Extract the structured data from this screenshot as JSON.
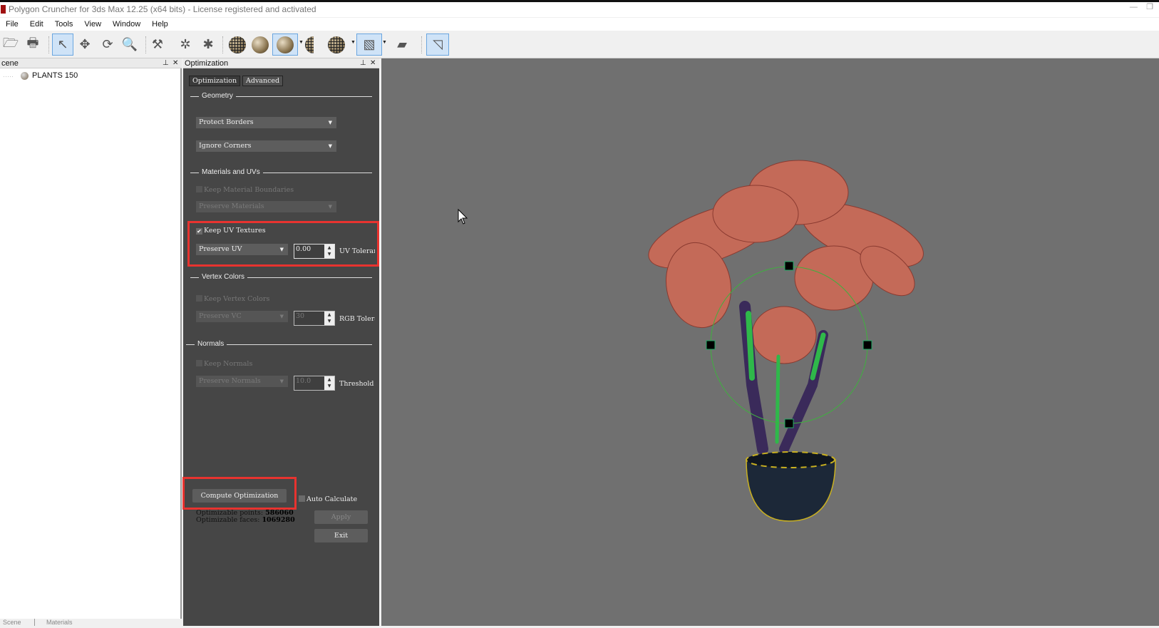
{
  "window": {
    "title": "Polygon Cruncher for 3ds Max 12.25 (x64 bits) - License registered and activated"
  },
  "menu": [
    "File",
    "Edit",
    "Tools",
    "View",
    "Window",
    "Help"
  ],
  "toolbar": {
    "icons": [
      "open-icon",
      "print-icon",
      "select-arrow-icon",
      "move-icon",
      "rotate-icon",
      "zoom-icon",
      "tools-icon",
      "wireframe-icon",
      "star-mesh-icon",
      "sphere-grid-icon",
      "sphere-smooth-icon",
      "sphere-shaded-icon",
      "sphere-half-icon",
      "sphere-half-grid-icon",
      "texture-icon",
      "material-icon",
      "viewport-icon"
    ],
    "selected": [
      "select-arrow-icon",
      "sphere-shaded-icon",
      "texture-icon",
      "viewport-icon"
    ]
  },
  "scene_panel": {
    "title": "cene",
    "tree": [
      {
        "label": "PLANTS 150"
      }
    ],
    "tabs": [
      "Scene",
      "Materials"
    ]
  },
  "optimization_panel": {
    "title": "Optimization",
    "tabs": [
      "Optimization",
      "Advanced"
    ],
    "geometry": {
      "header": "Geometry",
      "dropdown1": "Protect Borders",
      "dropdown2": "Ignore Corners"
    },
    "materials": {
      "header": "Materials and UVs",
      "keep_material_boundaries": "Keep Material Boundaries",
      "preserve_materials": "Preserve Materials",
      "keep_uv_textures": "Keep UV Textures",
      "keep_uv_checked": true,
      "preserve_uv": "Preserve UV",
      "uv_tolerance_value": "0.00",
      "uv_tolerance_label": "UV Tolerance"
    },
    "vertex_colors": {
      "header": "Vertex Colors",
      "keep_vertex_colors": "Keep Vertex Colors",
      "preserve_vc": "Preserve VC",
      "rgb_value": "30",
      "rgb_label": "RGB Tolerance"
    },
    "normals": {
      "header": "Normals",
      "keep_normals": "Keep Normals",
      "preserve_normals": "Preserve Normals",
      "threshold_value": "10.0",
      "threshold_label": "Threshold"
    },
    "compute_button": "Compute Optimization",
    "auto_calculate": "Auto Calculate",
    "points_label": "Optimizable points:",
    "points_value": "586060",
    "faces_label": "Optimizable faces:",
    "faces_value": "1069280",
    "apply_button": "Apply",
    "exit_button": "Exit"
  },
  "colors": {
    "highlight": "#e8332f",
    "panel_bg": "#464646",
    "viewport_bg": "#707070"
  }
}
